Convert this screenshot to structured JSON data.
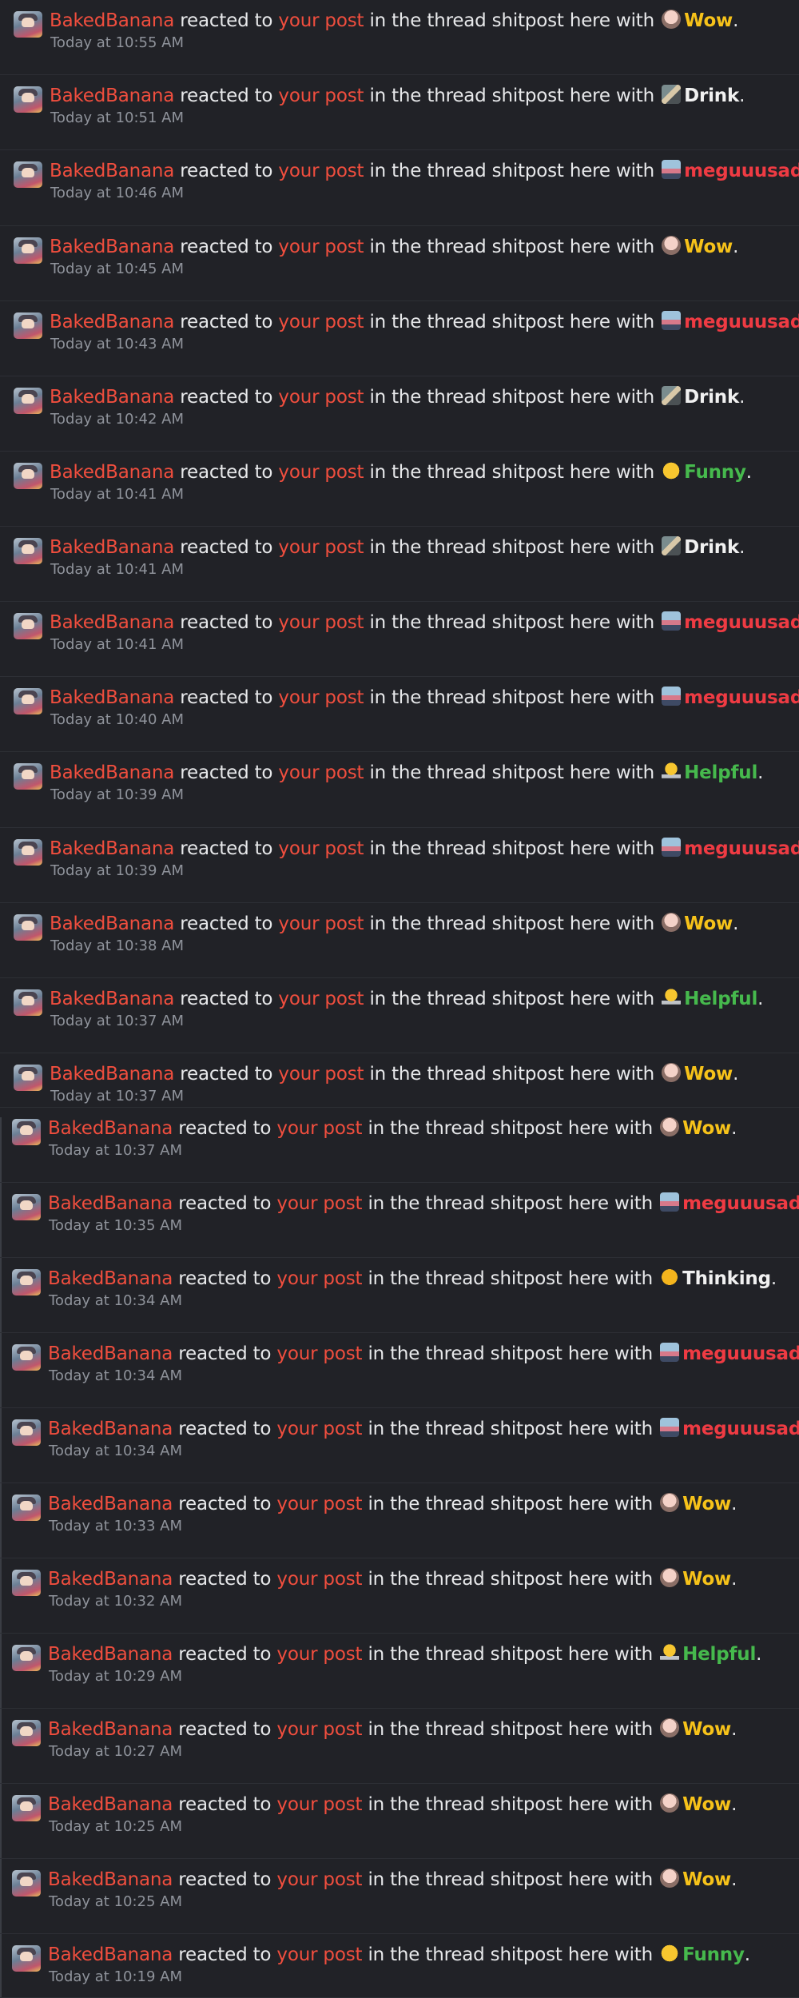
{
  "alerts": [
    {
      "user": "BakedBanana",
      "verb": "reacted to",
      "link": "your post",
      "thread_text": "in the thread shitpost here with",
      "reaction": "Wow",
      "reaction_icon": "wow-emoji-icon",
      "reaction_color": "#f6c21a",
      "time": "Today at 10:55 AM"
    },
    {
      "user": "BakedBanana",
      "verb": "reacted to",
      "link": "your post",
      "thread_text": "in the thread shitpost here with",
      "reaction": "Drink",
      "reaction_icon": "drink-emoji-icon",
      "reaction_color": "#f1f1f1",
      "time": "Today at 10:51 AM"
    },
    {
      "user": "BakedBanana",
      "verb": "reacted to",
      "link": "your post",
      "thread_text": "in the thread shitpost here with",
      "reaction": "meguuusad",
      "reaction_icon": "meguuusad-emoji-icon",
      "reaction_color": "#ef3b43",
      "time": "Today at 10:46 AM"
    },
    {
      "user": "BakedBanana",
      "verb": "reacted to",
      "link": "your post",
      "thread_text": "in the thread shitpost here with",
      "reaction": "Wow",
      "reaction_icon": "wow-emoji-icon",
      "reaction_color": "#f6c21a",
      "time": "Today at 10:45 AM"
    },
    {
      "user": "BakedBanana",
      "verb": "reacted to",
      "link": "your post",
      "thread_text": "in the thread shitpost here with",
      "reaction": "meguuusad",
      "reaction_icon": "meguuusad-emoji-icon",
      "reaction_color": "#ef3b43",
      "time": "Today at 10:43 AM"
    },
    {
      "user": "BakedBanana",
      "verb": "reacted to",
      "link": "your post",
      "thread_text": "in the thread shitpost here with",
      "reaction": "Drink",
      "reaction_icon": "drink-emoji-icon",
      "reaction_color": "#f1f1f1",
      "time": "Today at 10:42 AM"
    },
    {
      "user": "BakedBanana",
      "verb": "reacted to",
      "link": "your post",
      "thread_text": "in the thread shitpost here with",
      "reaction": "Funny",
      "reaction_icon": "funny-emoji-icon",
      "reaction_color": "#46b94d",
      "time": "Today at 10:41 AM"
    },
    {
      "user": "BakedBanana",
      "verb": "reacted to",
      "link": "your post",
      "thread_text": "in the thread shitpost here with",
      "reaction": "Drink",
      "reaction_icon": "drink-emoji-icon",
      "reaction_color": "#f1f1f1",
      "time": "Today at 10:41 AM"
    },
    {
      "user": "BakedBanana",
      "verb": "reacted to",
      "link": "your post",
      "thread_text": "in the thread shitpost here with",
      "reaction": "meguuusad",
      "reaction_icon": "meguuusad-emoji-icon",
      "reaction_color": "#ef3b43",
      "time": "Today at 10:41 AM"
    },
    {
      "user": "BakedBanana",
      "verb": "reacted to",
      "link": "your post",
      "thread_text": "in the thread shitpost here with",
      "reaction": "meguuusad",
      "reaction_icon": "meguuusad-emoji-icon",
      "reaction_color": "#ef3b43",
      "time": "Today at 10:40 AM"
    },
    {
      "user": "BakedBanana",
      "verb": "reacted to",
      "link": "your post",
      "thread_text": "in the thread shitpost here with",
      "reaction": "Helpful",
      "reaction_icon": "lightbulb-emoji-icon",
      "reaction_color": "#46b94d",
      "time": "Today at 10:39 AM"
    },
    {
      "user": "BakedBanana",
      "verb": "reacted to",
      "link": "your post",
      "thread_text": "in the thread shitpost here with",
      "reaction": "meguuusad",
      "reaction_icon": "meguuusad-emoji-icon",
      "reaction_color": "#ef3b43",
      "time": "Today at 10:39 AM"
    },
    {
      "user": "BakedBanana",
      "verb": "reacted to",
      "link": "your post",
      "thread_text": "in the thread shitpost here with",
      "reaction": "Wow",
      "reaction_icon": "wow-emoji-icon",
      "reaction_color": "#f6c21a",
      "time": "Today at 10:38 AM"
    },
    {
      "user": "BakedBanana",
      "verb": "reacted to",
      "link": "your post",
      "thread_text": "in the thread shitpost here with",
      "reaction": "Helpful",
      "reaction_icon": "lightbulb-emoji-icon",
      "reaction_color": "#46b94d",
      "time": "Today at 10:37 AM"
    },
    {
      "user": "BakedBanana",
      "verb": "reacted to",
      "link": "your post",
      "thread_text": "in the thread shitpost here with",
      "reaction": "Wow",
      "reaction_icon": "wow-emoji-icon",
      "reaction_color": "#f6c21a",
      "time": "Today at 10:37 AM"
    },
    {
      "user": "BakedBanana",
      "verb": "reacted to",
      "link": "your post",
      "thread_text": "in the thread shitpost here with",
      "reaction": "Wow",
      "reaction_icon": "wow-emoji-icon",
      "reaction_color": "#f6c21a",
      "time": "Today at 10:37 AM"
    },
    {
      "user": "BakedBanana",
      "verb": "reacted to",
      "link": "your post",
      "thread_text": "in the thread shitpost here with",
      "reaction": "meguuusad",
      "reaction_icon": "meguuusad-emoji-icon",
      "reaction_color": "#ef3b43",
      "time": "Today at 10:35 AM"
    },
    {
      "user": "BakedBanana",
      "verb": "reacted to",
      "link": "your post",
      "thread_text": "in the thread shitpost here with",
      "reaction": "Thinking",
      "reaction_icon": "thinking-emoji-icon",
      "reaction_color": "#f1f1f1",
      "time": "Today at 10:34 AM"
    },
    {
      "user": "BakedBanana",
      "verb": "reacted to",
      "link": "your post",
      "thread_text": "in the thread shitpost here with",
      "reaction": "meguuusad",
      "reaction_icon": "meguuusad-emoji-icon",
      "reaction_color": "#ef3b43",
      "time": "Today at 10:34 AM"
    },
    {
      "user": "BakedBanana",
      "verb": "reacted to",
      "link": "your post",
      "thread_text": "in the thread shitpost here with",
      "reaction": "meguuusad",
      "reaction_icon": "meguuusad-emoji-icon",
      "reaction_color": "#ef3b43",
      "time": "Today at 10:34 AM"
    },
    {
      "user": "BakedBanana",
      "verb": "reacted to",
      "link": "your post",
      "thread_text": "in the thread shitpost here with",
      "reaction": "Wow",
      "reaction_icon": "wow-emoji-icon",
      "reaction_color": "#f6c21a",
      "time": "Today at 10:33 AM"
    },
    {
      "user": "BakedBanana",
      "verb": "reacted to",
      "link": "your post",
      "thread_text": "in the thread shitpost here with",
      "reaction": "Wow",
      "reaction_icon": "wow-emoji-icon",
      "reaction_color": "#f6c21a",
      "time": "Today at 10:32 AM"
    },
    {
      "user": "BakedBanana",
      "verb": "reacted to",
      "link": "your post",
      "thread_text": "in the thread shitpost here with",
      "reaction": "Helpful",
      "reaction_icon": "lightbulb-emoji-icon",
      "reaction_color": "#46b94d",
      "time": "Today at 10:29 AM"
    },
    {
      "user": "BakedBanana",
      "verb": "reacted to",
      "link": "your post",
      "thread_text": "in the thread shitpost here with",
      "reaction": "Wow",
      "reaction_icon": "wow-emoji-icon",
      "reaction_color": "#f6c21a",
      "time": "Today at 10:27 AM"
    },
    {
      "user": "BakedBanana",
      "verb": "reacted to",
      "link": "your post",
      "thread_text": "in the thread shitpost here with",
      "reaction": "Wow",
      "reaction_icon": "wow-emoji-icon",
      "reaction_color": "#f6c21a",
      "time": "Today at 10:25 AM"
    },
    {
      "user": "BakedBanana",
      "verb": "reacted to",
      "link": "your post",
      "thread_text": "in the thread shitpost here with",
      "reaction": "Wow",
      "reaction_icon": "wow-emoji-icon",
      "reaction_color": "#f6c21a",
      "time": "Today at 10:25 AM"
    },
    {
      "user": "BakedBanana",
      "verb": "reacted to",
      "link": "your post",
      "thread_text": "in the thread shitpost here with",
      "reaction": "Funny",
      "reaction_icon": "funny-emoji-icon",
      "reaction_color": "#46b94d",
      "time": "Today at 10:19 AM"
    }
  ]
}
